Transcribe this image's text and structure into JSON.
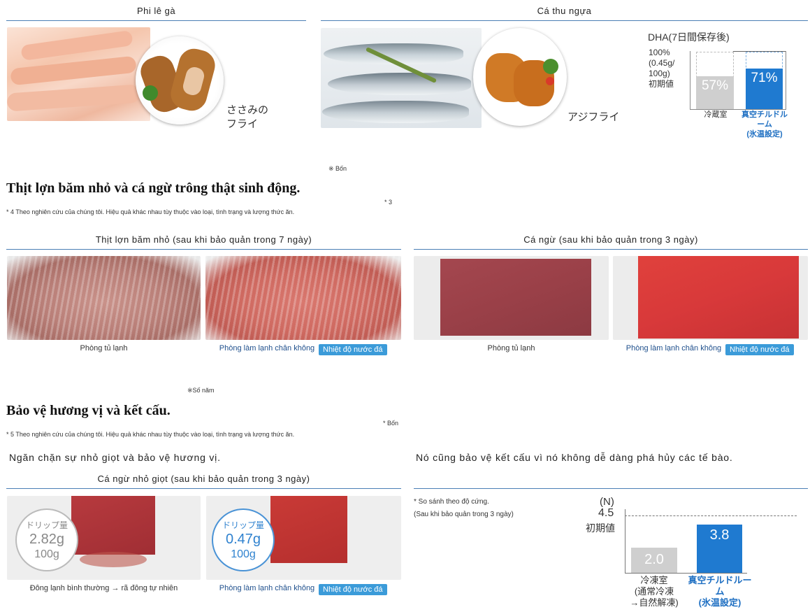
{
  "section1": {
    "chicken": {
      "title": "Phi lê gà",
      "dish_label": "ささみの\nフライ"
    },
    "mackerel": {
      "title": "Cá thu ngựa",
      "dish_label": "アジフライ",
      "dha_chart": {
        "title": "DHA(7日間保存後)",
        "baseline_label": "100%\n(0.45g/\n100g)\n初期値",
        "bars": [
          {
            "label": "冷蔵室",
            "value_text": "57%",
            "value": 57,
            "color": "#cfcfcf"
          },
          {
            "label": "真空チルドルーム\n(氷温設定)",
            "value_text": "71%",
            "value": 71,
            "color": "#1f7ad0"
          }
        ]
      }
    },
    "footnote_mark": "※ Bốn"
  },
  "section2": {
    "heading": "Thịt lợn băm nhỏ và cá ngừ trông thật sinh động.",
    "mark": "* 3",
    "note": "* 4 Theo nghiên cứu của chúng tôi. Hiệu quả khác nhau tùy thuộc vào loại, tình trạng và lượng thức ăn.",
    "pork": {
      "title": "Thịt lợn băm nhỏ (sau khi bảo quản trong 7 ngày)",
      "left_caption": "Phòng tủ lạnh",
      "right_caption": "Phòng làm lạnh chân không",
      "badge": "Nhiệt độ nước đá"
    },
    "tuna": {
      "title": "Cá ngừ (sau khi bảo quản trong 3 ngày)",
      "left_caption": "Phòng tủ lạnh",
      "right_caption": "Phòng làm lạnh chân không",
      "badge": "Nhiệt độ nước đá"
    },
    "footnote_mark": "※Số năm"
  },
  "section3": {
    "heading": "Bảo vệ hương vị và kết cấu.",
    "mark": "* Bốn",
    "note": "* 5 Theo nghiên cứu của chúng tôi. Hiệu quả khác nhau tùy thuộc vào loại, tình trạng và lượng thức ăn.",
    "left_sub": "Ngăn chặn sự nhỏ giọt và bảo vệ hương vị.",
    "right_sub": "Nó cũng bảo vệ kết cấu vì nó không dễ dàng phá hủy các tế bào.",
    "drip": {
      "title": "Cá ngừ nhỏ giọt (sau khi bảo quản trong 3 ngày)",
      "left": {
        "label": "ドリップ量",
        "value": "2.82g",
        "unit": "100g",
        "caption": "Đông lạnh bình thường → rã đông tự nhiên"
      },
      "right": {
        "label": "ドリップ量",
        "value": "0.47g",
        "unit": "100g",
        "caption": "Phòng làm lạnh chân không",
        "badge": "Nhiệt độ nước đá"
      }
    },
    "firmness": {
      "note1": "* So sánh theo độ cứng.",
      "note2": "(Sau khi bảo quản trong 3 ngày)",
      "unit": "(N)",
      "baseline_value": "4.5",
      "baseline_label": "初期値",
      "bars": [
        {
          "label": "冷凍室\n(通常冷凍\n→自然解凍)",
          "value_text": "2.0",
          "value": 2.0,
          "color": "#cfcfcf"
        },
        {
          "label": "真空チルドルーム\n(氷温設定)",
          "value_text": "3.8",
          "value": 3.8,
          "color": "#1f7ad0"
        }
      ]
    }
  }
}
